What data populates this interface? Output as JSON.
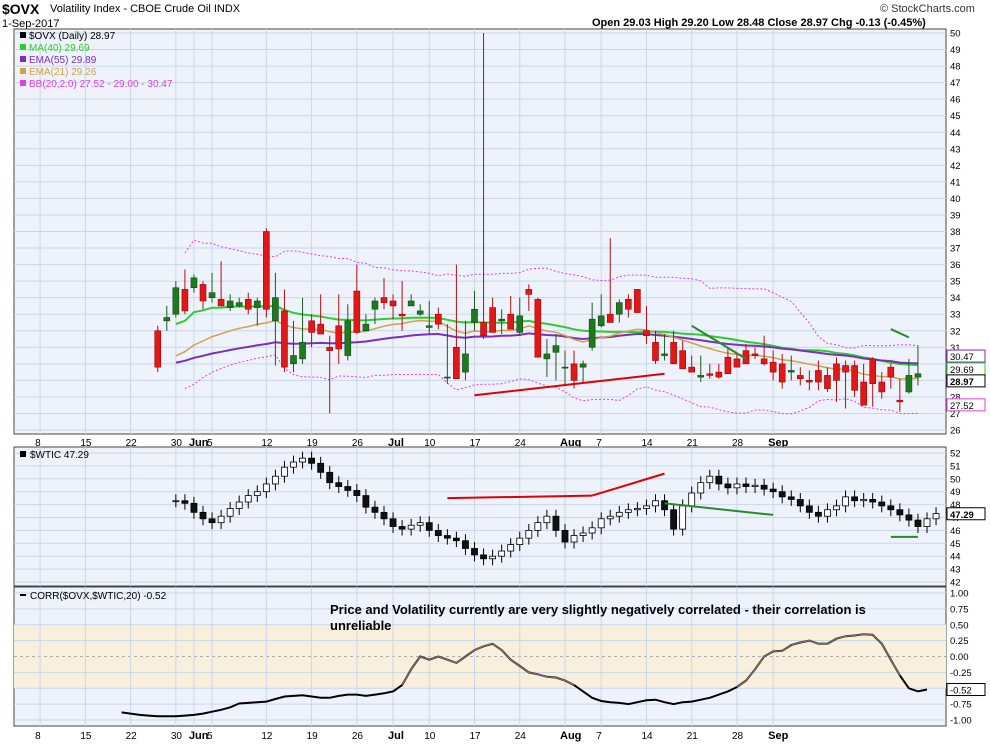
{
  "header": {
    "symbol": "$OVX",
    "name": "Volatility Index - CBOE Crude Oil INDX",
    "date": "1-Sep-2017",
    "brand": "© StockCharts.com",
    "ohlc_text": "Open 29.03  High 29.20  Low 28.48  Close 28.97  Chg -0.13 (-0.45%)"
  },
  "note": "Price and Volatility currently are very slightly negatively correlated - their correlation is unreliable",
  "chart_data": [
    {
      "type": "candlestick",
      "title": "$OVX (Daily) 28.97",
      "ylim": [
        26,
        50
      ],
      "yticks": [
        26,
        27,
        28,
        29,
        30,
        31,
        32,
        33,
        34,
        35,
        36,
        37,
        38,
        39,
        40,
        41,
        42,
        43,
        44,
        45,
        46,
        47,
        48,
        49,
        50
      ],
      "xlabels": [
        "8",
        "15",
        "22",
        "30",
        "Jun",
        "5",
        "12",
        "19",
        "26",
        "Jul",
        "10",
        "17",
        "24",
        "Aug",
        "7",
        "14",
        "21",
        "28",
        "Sep"
      ],
      "xlabel_index": [
        2,
        7,
        12,
        17,
        19,
        21,
        27,
        32,
        37,
        41,
        45,
        50,
        55,
        60,
        64,
        69,
        74,
        79,
        83
      ],
      "last_labels": [
        "30.47",
        "29.69",
        "28.97",
        "27.52"
      ],
      "legend": [
        {
          "label": "$OVX (Daily) 28.97",
          "color": "#000000"
        },
        {
          "label": "MA(40) 29.69",
          "color": "#2ecc2e"
        },
        {
          "label": "EMA(55) 29.89",
          "color": "#7b2fbe"
        },
        {
          "label": "EMA(21) 29.26",
          "color": "#d2a04a"
        },
        {
          "label": "BB(20,2.0) 27.52 - 29.00 - 30.47",
          "color": "#e040e0"
        }
      ],
      "candles": [
        [
          32.0,
          32.3,
          29.5,
          29.8
        ],
        [
          32.6,
          33.5,
          32.0,
          32.8
        ],
        [
          33.0,
          35.0,
          32.8,
          34.6
        ],
        [
          34.5,
          35.7,
          33.0,
          33.2
        ],
        [
          34.6,
          35.4,
          34.3,
          35.2
        ],
        [
          34.8,
          35.0,
          33.3,
          33.8
        ],
        [
          34.0,
          35.5,
          33.7,
          34.3
        ],
        [
          33.9,
          36.2,
          33.6,
          33.5
        ],
        [
          33.4,
          34.2,
          33.2,
          33.8
        ],
        [
          33.5,
          34.0,
          33.4,
          33.7
        ],
        [
          33.9,
          34.3,
          33.0,
          33.3
        ],
        [
          33.4,
          34.0,
          32.3,
          33.8
        ],
        [
          38.0,
          38.2,
          32.8,
          33.3
        ],
        [
          32.6,
          35.5,
          29.9,
          34.0
        ],
        [
          33.2,
          34.5,
          29.5,
          29.8
        ],
        [
          30.0,
          32.6,
          29.5,
          30.5
        ],
        [
          30.3,
          34.0,
          30.0,
          31.3
        ],
        [
          32.6,
          33.0,
          31.0,
          31.9
        ],
        [
          32.4,
          34.2,
          31.8,
          31.8
        ],
        [
          31.0,
          31.7,
          27.0,
          30.8
        ],
        [
          32.3,
          34.2,
          30.0,
          30.9
        ],
        [
          30.5,
          33.6,
          30.2,
          32.6
        ],
        [
          34.4,
          36.0,
          31.8,
          31.9
        ],
        [
          32.0,
          33.0,
          32.2,
          32.4
        ],
        [
          33.3,
          34.0,
          32.4,
          33.8
        ],
        [
          34.0,
          35.2,
          33.3,
          33.7
        ],
        [
          33.8,
          34.2,
          32.7,
          33.5
        ],
        [
          33.0,
          35.0,
          32.0,
          32.9
        ],
        [
          33.5,
          34.2,
          33.6,
          33.8
        ],
        [
          33.0,
          33.6,
          32.9,
          33.2
        ],
        [
          32.2,
          33.8,
          31.8,
          32.3
        ],
        [
          33.0,
          33.4,
          32.1,
          32.4
        ],
        [
          29.2,
          32.4,
          28.8,
          29.2
        ],
        [
          31.0,
          36.0,
          30.5,
          29.1
        ],
        [
          29.5,
          32.6,
          29.0,
          30.6
        ],
        [
          32.5,
          34.4,
          32.0,
          33.3
        ],
        [
          32.5,
          50.0,
          31.5,
          31.7
        ],
        [
          33.4,
          34.0,
          32.2,
          31.9
        ],
        [
          32.6,
          33.3,
          31.8,
          32.7
        ],
        [
          33.0,
          34.1,
          32.2,
          32.1
        ],
        [
          31.9,
          34.0,
          31.7,
          32.9
        ],
        [
          34.5,
          34.8,
          33.2,
          34.2
        ],
        [
          33.9,
          34.0,
          31.5,
          30.4
        ],
        [
          30.3,
          31.5,
          29.2,
          30.6
        ],
        [
          30.7,
          31.8,
          29.0,
          31.1
        ],
        [
          29.8,
          30.8,
          28.7,
          29.8
        ],
        [
          30.0,
          30.8,
          28.5,
          29.0
        ],
        [
          29.8,
          30.2,
          28.8,
          30.0
        ],
        [
          31.0,
          33.7,
          30.8,
          32.7
        ],
        [
          32.3,
          34.2,
          32.2,
          32.9
        ],
        [
          33.0,
          37.6,
          32.5,
          32.5
        ],
        [
          33.0,
          33.9,
          32.5,
          33.7
        ],
        [
          33.9,
          34.2,
          32.8,
          33.3
        ],
        [
          34.5,
          34.5,
          33.3,
          33.1
        ],
        [
          32.0,
          33.5,
          31.2,
          31.7
        ],
        [
          31.3,
          32.0,
          30.0,
          30.2
        ],
        [
          30.5,
          31.8,
          30.2,
          30.6
        ],
        [
          31.3,
          32.0,
          30.3,
          30.0
        ],
        [
          30.8,
          31.4,
          29.8,
          29.7
        ],
        [
          29.8,
          30.5,
          29.5,
          29.5
        ],
        [
          29.2,
          30.5,
          28.9,
          29.3
        ],
        [
          29.4,
          30.0,
          29.1,
          29.3
        ],
        [
          29.5,
          30.0,
          29.1,
          29.2
        ],
        [
          30.4,
          31.0,
          29.4,
          29.4
        ],
        [
          30.3,
          30.6,
          29.8,
          29.8
        ],
        [
          30.8,
          31.2,
          30.0,
          30.0
        ],
        [
          30.6,
          31.0,
          30.3,
          30.5
        ],
        [
          30.3,
          31.7,
          29.9,
          30.0
        ],
        [
          30.1,
          30.8,
          29.0,
          29.5
        ],
        [
          30.0,
          30.6,
          28.5,
          28.9
        ],
        [
          29.5,
          30.5,
          29.0,
          29.6
        ],
        [
          29.3,
          29.8,
          28.7,
          29.1
        ],
        [
          29.0,
          29.6,
          28.4,
          28.9
        ],
        [
          29.6,
          30.2,
          28.4,
          28.9
        ],
        [
          29.3,
          29.8,
          28.3,
          28.5
        ],
        [
          30.0,
          30.4,
          27.7,
          29.0
        ],
        [
          29.9,
          30.2,
          27.3,
          29.5
        ],
        [
          29.9,
          30.2,
          28.0,
          28.4
        ],
        [
          28.9,
          30.0,
          28.1,
          27.5
        ],
        [
          30.3,
          30.4,
          27.4,
          28.8
        ],
        [
          28.9,
          29.5,
          27.9,
          28.3
        ],
        [
          29.8,
          30.0,
          28.5,
          29.2
        ],
        [
          27.8,
          29.1,
          27.1,
          27.7
        ],
        [
          28.3,
          30.3,
          28.2,
          29.3
        ],
        [
          29.2,
          31.1,
          28.7,
          29.4
        ]
      ],
      "annotations": [
        {
          "color": "#e00000",
          "from": [
            50,
            28.1
          ],
          "to": [
            71,
            29.4
          ]
        },
        {
          "color": "#2a8a2a",
          "from": [
            74,
            32.3
          ],
          "to": [
            80,
            30.3
          ]
        },
        {
          "color": "#2a8a2a",
          "from": [
            96,
            32.1
          ],
          "to": [
            98,
            31.6
          ]
        }
      ]
    },
    {
      "type": "candlestick",
      "title": "$WTIC 47.29",
      "ylim": [
        42,
        52
      ],
      "yticks": [
        42,
        43,
        44,
        45,
        46,
        47,
        48,
        49,
        50,
        51,
        52
      ],
      "last_label": "47.29",
      "series_note": "hollow/black price bars"
    },
    {
      "type": "line",
      "title": "CORR($OVX,$WTIC,20) -0.52",
      "ylim": [
        -1.0,
        1.0
      ],
      "yticks": [
        -1.0,
        -0.75,
        -0.5,
        -0.25,
        0.0,
        0.25,
        0.5,
        0.75,
        1.0
      ],
      "ytick_labels": [
        "-1.00",
        "-0.75",
        "-0.50",
        "-0.25",
        "0.00",
        "0.25",
        "0.50",
        "0.75",
        "1.00"
      ],
      "last_label": "-0.52",
      "band": [
        -0.5,
        0.5
      ]
    }
  ]
}
